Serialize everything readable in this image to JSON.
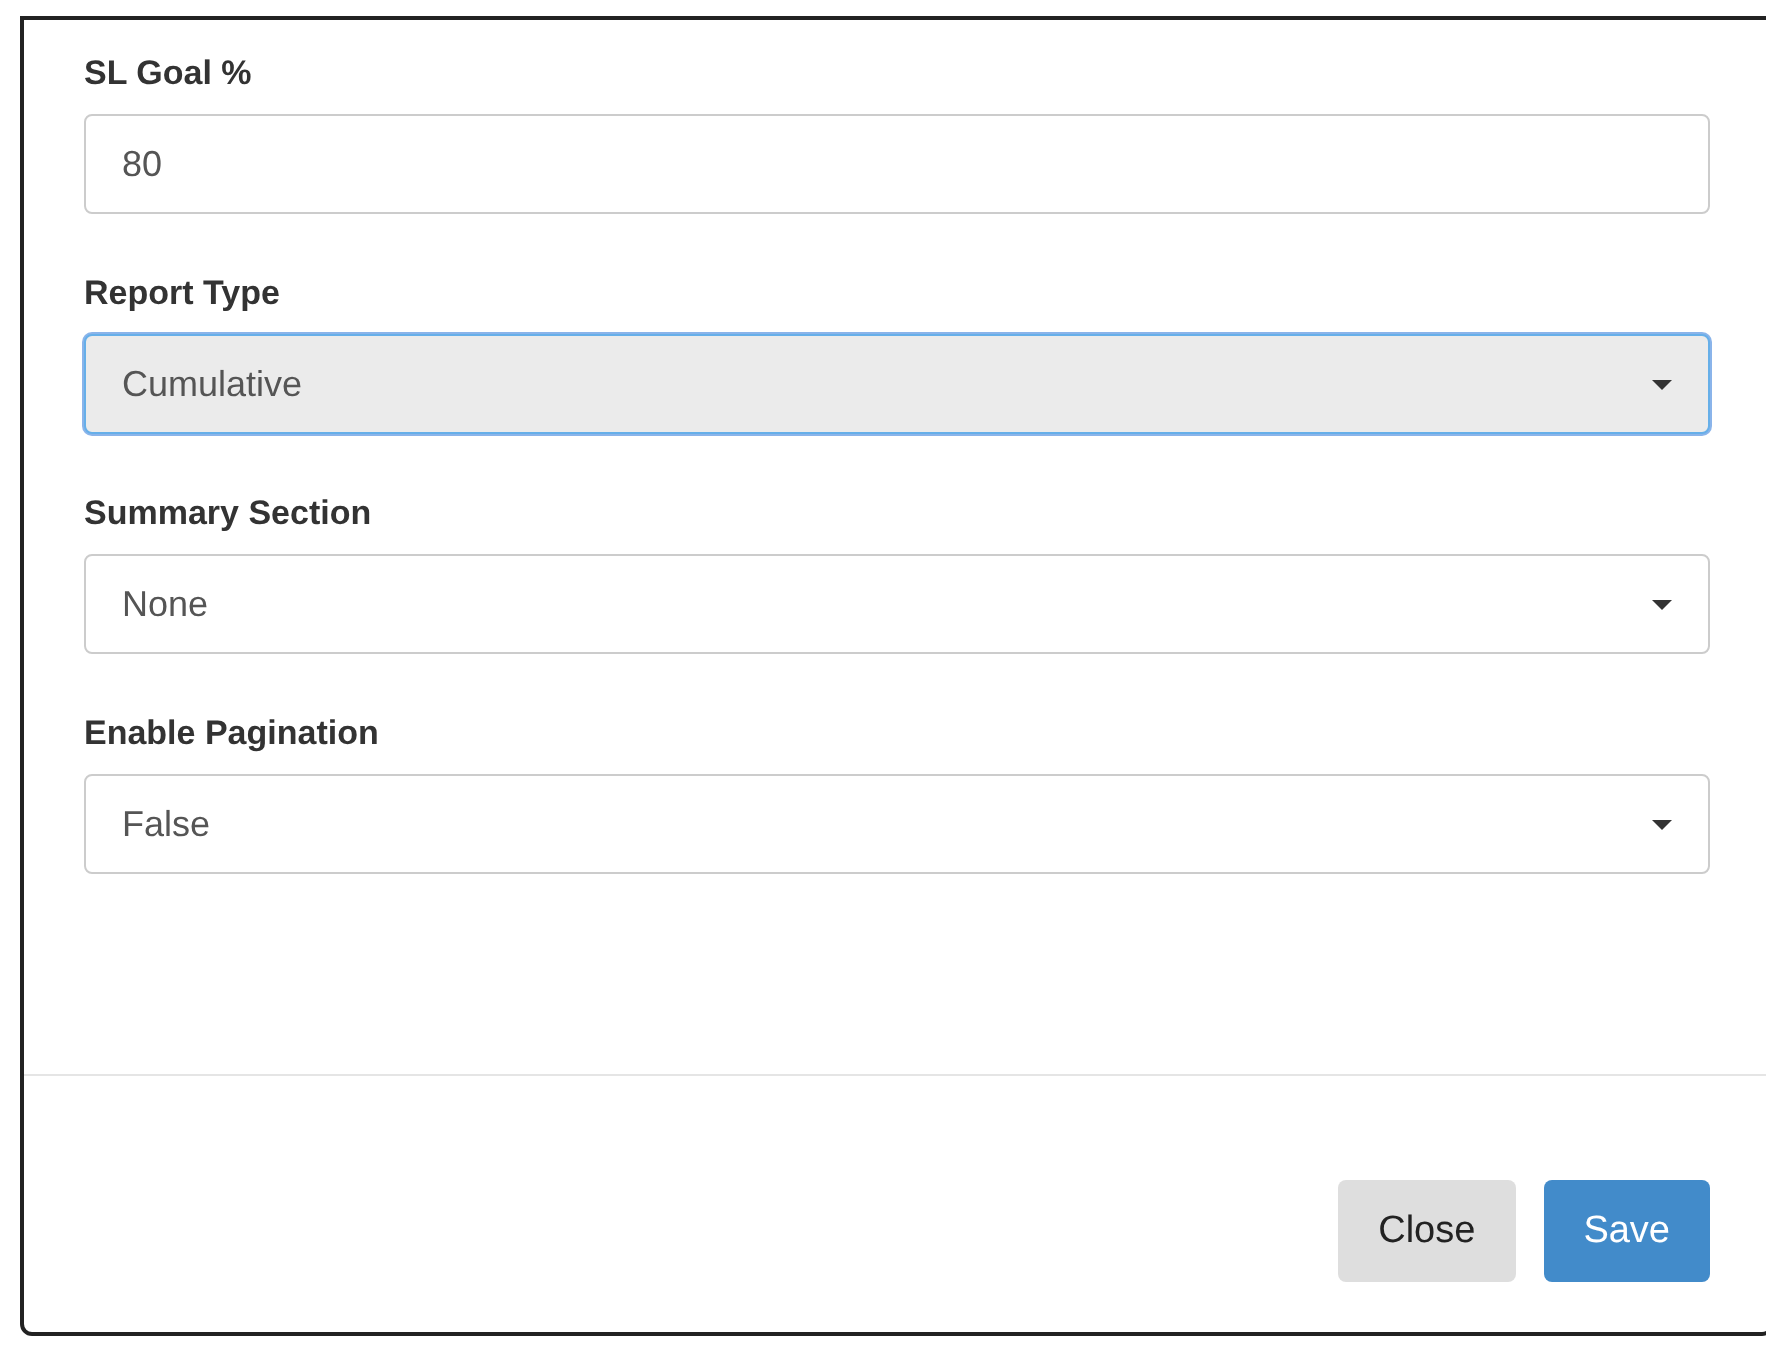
{
  "fields": [
    {
      "label": "SL Goal %",
      "kind": "text",
      "value": "80",
      "focused": false
    },
    {
      "label": "Report Type",
      "kind": "select",
      "value": "Cumulative",
      "focused": true
    },
    {
      "label": "Summary Section",
      "kind": "select",
      "value": "None",
      "focused": false
    },
    {
      "label": "Enable Pagination",
      "kind": "select",
      "value": "False",
      "focused": false
    }
  ],
  "buttons": [
    {
      "label": "Close",
      "kind": "default"
    },
    {
      "label": "Save",
      "kind": "primary"
    }
  ]
}
